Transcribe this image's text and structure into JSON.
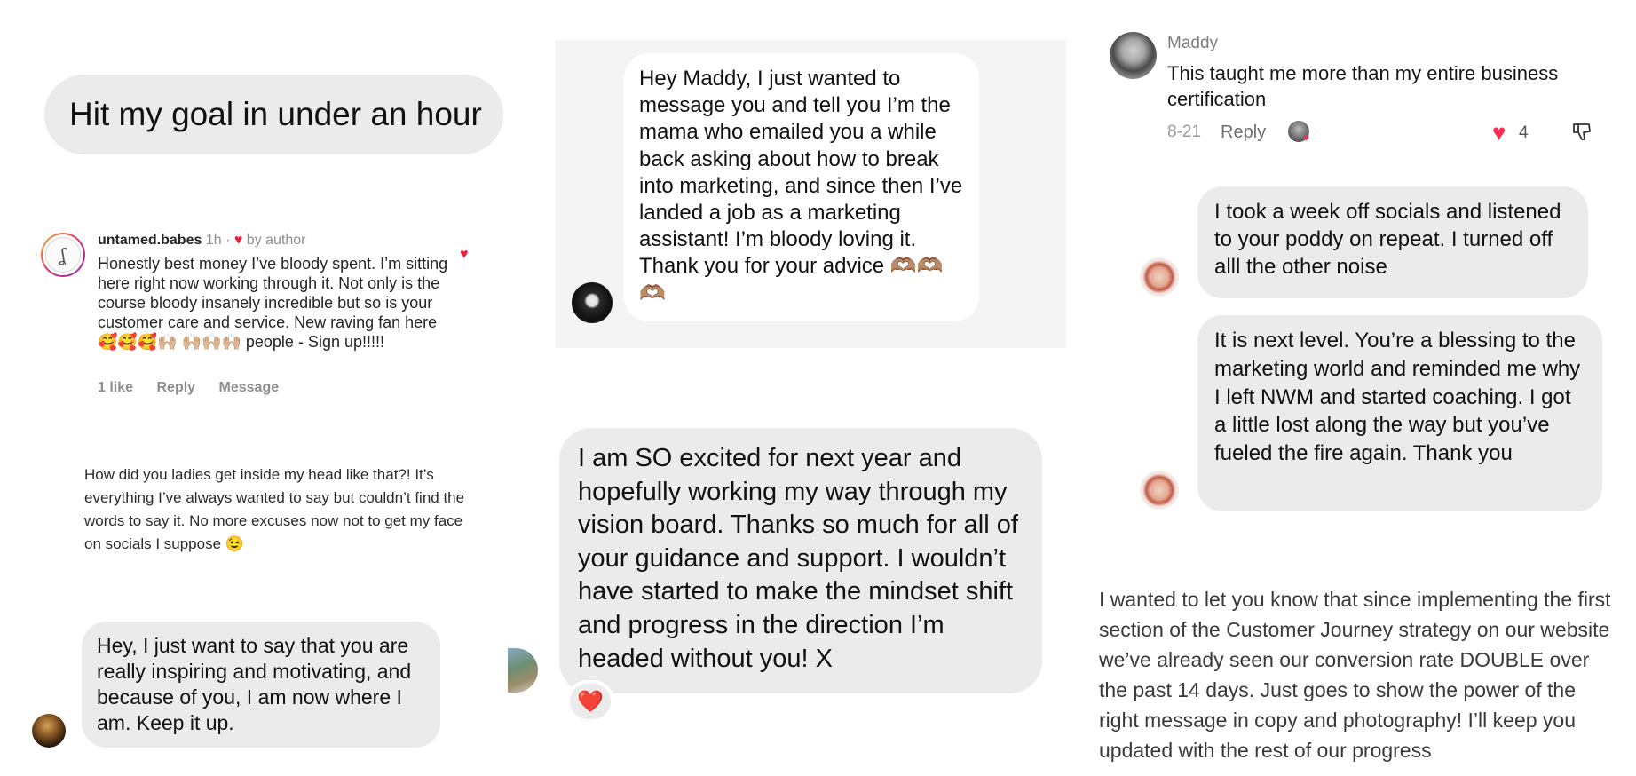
{
  "left": {
    "goal_bubble": "Hit my goal in under an hour",
    "comment": {
      "avatar_letter": "ʆ",
      "username": "untamed.babes",
      "time": "1h",
      "separator": "·",
      "liked_by": "by author",
      "body": "Honestly best money I’ve bloody spent. I’m sitting here right now working through it. Not only is the course bloody insanely incredible but so is your customer care and service. New raving fan here 🥰🥰🥰🙌🏼 🙌🏼🙌🏼🙌🏼 people - Sign up!!!!!",
      "actions": {
        "likes": "1 like",
        "reply": "Reply",
        "message": "Message"
      }
    },
    "ladies_text": "How did you ladies get inside my head like that?! It’s everything I’ve always wanted to say but couldn’t find the words to say it. No more excuses now not to get my face on socials I suppose 😉",
    "inspiring_bubble": "Hey, I just want to say that you are really inspiring and motivating, and because of you, I am now where I am. Keep it up."
  },
  "middle": {
    "maddy_message": "Hey Maddy, I just wanted to message you and tell you I’m the mama who emailed you a while back asking about how to break into marketing, and since then I’ve landed a job as a marketing assistant! I’m bloody loving it. Thank you for your advice 🫶🏽🫶🏽 🫶🏽",
    "excited_message": "I am SO excited for next year and hopefully working my way through my vision board. Thanks so much for all of your guidance and support. I wouldn’t have started to make the mindset shift and progress in the direction I’m headed without you! X",
    "reaction": "❤️"
  },
  "right": {
    "maddy_comment": {
      "name": "Maddy",
      "text": "This taught me more than my entire business certification",
      "date": "8-21",
      "reply": "Reply",
      "like_count": "4"
    },
    "socials_bubble": "I took a week off socials and listened to your poddy on repeat. I turned off alll the other noise",
    "nextlevel_bubble": "It is next level. You’re a blessing to the marketing world and reminded me why I left NWM and started coaching. I got a little lost along the way but you’ve fueled the fire again. Thank you",
    "journey_text": "I wanted to let you know that since implementing the first section of the Customer Journey strategy on our website we’ve already seen our conversion rate DOUBLE over the past 14 days. Just goes to show the power of the right message in copy and photography! I’ll keep you updated with the rest of our progress"
  },
  "colors": {
    "bubble_grey": "#ebebeb",
    "heart_red": "#ed1f3c",
    "tiktok_pink": "#fe2c55"
  },
  "icons": [
    "heart-icon",
    "dislike-icon",
    "reaction-heart-icon"
  ]
}
